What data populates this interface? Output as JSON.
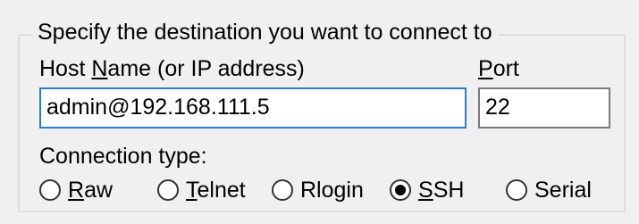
{
  "group": {
    "title": "Specify the destination you want to connect to"
  },
  "host": {
    "label_pre": "Host ",
    "label_access": "N",
    "label_post": "ame (or IP address)",
    "value": "admin@192.168.111.5"
  },
  "port": {
    "label_access": "P",
    "label_post": "ort",
    "value": "22"
  },
  "connection": {
    "label": "Connection type:",
    "selected": "SSH",
    "options": [
      {
        "access": "R",
        "rest": "aw"
      },
      {
        "access": "T",
        "rest": "elnet"
      },
      {
        "access": "",
        "rest": "Rlogin"
      },
      {
        "access": "S",
        "rest": "SH"
      },
      {
        "access": "",
        "rest": "Serial"
      }
    ]
  }
}
